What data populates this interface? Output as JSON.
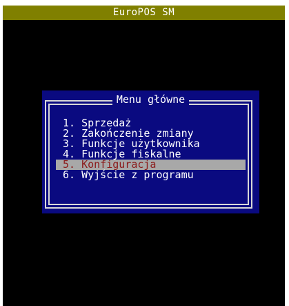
{
  "window": {
    "title": "EuroPOS SM"
  },
  "menu": {
    "title": "Menu główne",
    "selected_index": 4,
    "items": [
      {
        "label": "1. Sprzedaż"
      },
      {
        "label": "2. Zakończenie zmiany"
      },
      {
        "label": "3. Funkcje użytkownika"
      },
      {
        "label": "4. Funkcje fiskalne"
      },
      {
        "label": "5. Konfiguracja"
      },
      {
        "label": "6. Wyjście z programu"
      }
    ]
  },
  "colors": {
    "title_bar_bg": "#808000",
    "dialog_bg": "#0a0a80",
    "selection_bg": "#a8a8a8",
    "selection_text": "#8b1a1a",
    "screen_bg": "#000000"
  }
}
